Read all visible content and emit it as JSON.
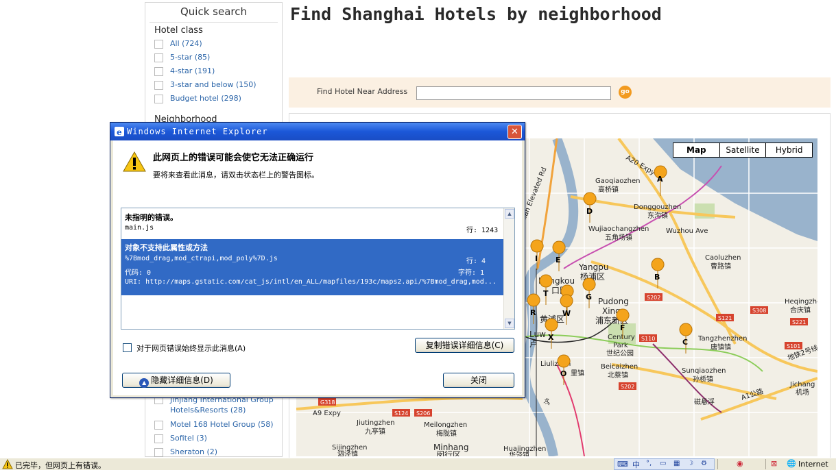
{
  "sidebar": {
    "title": "Quick search",
    "hotel_class": {
      "heading": "Hotel class",
      "items": [
        "All (724)",
        "5-star (85)",
        "4-star (191)",
        "3-star and below (150)",
        "Budget hotel (298)"
      ]
    },
    "neighborhood": {
      "heading": "Neighborhood"
    },
    "brands": [
      "Jinjiang International Group Hotels&Resorts (28)",
      "Motel 168 Hotel Group (58)",
      "Sofitel (3)",
      "Sheraton (2)"
    ]
  },
  "main": {
    "title": "Find Shanghai Hotels by neighborhood",
    "search": {
      "label": "Find Hotel Near Address",
      "value": "",
      "go_label": "go"
    }
  },
  "map": {
    "types": [
      "Map",
      "Satellite",
      "Hybrid"
    ],
    "selected_type": "Map",
    "labels": {
      "gaoqiao": "Gaoqiaozhen",
      "gaoqiao_cn": "高桥镇",
      "donggou": "Donggouzhen",
      "donggou_cn": "东沟镇",
      "wujiao": "Wujiaochangzhen",
      "wujiao_cn": "五角场镇",
      "wuzhou": "Wuzhou Ave",
      "yangpu": "Yangpu",
      "yangpu_cn": "杨浦区",
      "hongkou": "Hongkou",
      "hongkou_cn": "口区",
      "pudong": "Pudong",
      "xinqu": "Xinqu",
      "pudong_cn": "浦东新区",
      "caolu": "Caoluzhen",
      "caolu_cn": "曹路镇",
      "heqing": "Heqingzhen",
      "heqing_cn": "合庆镇",
      "huangpu_cn": "黄浦区",
      "luwan": "Luw",
      "lu_cn": "卢",
      "century": "Century",
      "park": "Park",
      "park_cn": "世纪公园",
      "tangzhen": "Tangzhenzhen",
      "tangzhen_cn": "唐镇镇",
      "liulizhen": "Liulizhen",
      "li_cn": "里镇",
      "beicai": "Beicaizhen",
      "beicai_cn": "北蔡镇",
      "sunqiao": "Sunqiaozhen",
      "sunqiao_cn": "孙桥镇",
      "jichang": "Jichang",
      "jichang_cn": "机场",
      "cixian": "磁悬浮",
      "a1": "A1公路",
      "metro2": "地铁2号线",
      "jiuting": "Jiutingzhen",
      "jiuting_cn": "九亭镇",
      "meilong": "Meilongzhen",
      "meilong_cn": "梅陇镇",
      "sijing": "Sijingzhen",
      "sijing_cn": "泗泾镇",
      "minhang": "Minhang",
      "minhang_cn": "闵行区",
      "huajing": "Huajingzhen",
      "huajing_cn": "华泾镇",
      "a20": "A20 Expy",
      "a9": "A9 Expy",
      "yixian": "Yixian Elevated Rd",
      "s202a": "S202",
      "s202b": "S202",
      "s110": "S110",
      "s121": "S121",
      "s308": "S308",
      "s221": "S221",
      "s101": "S101",
      "s124": "S124",
      "s206": "S206",
      "g318": "G318",
      "hu": "沪"
    },
    "markers": [
      "A",
      "B",
      "C",
      "D",
      "E",
      "F",
      "G",
      "I",
      "T",
      "U",
      "R",
      "W",
      "X",
      "O"
    ]
  },
  "dialog": {
    "title": "Windows Internet Explorer",
    "close_glyph": "✕",
    "heading": "此网页上的错误可能会使它无法正确运行",
    "hint": "要将来查看此消息，请双击状态栏上的警告图标。",
    "errors": [
      {
        "message": "未指明的错误。",
        "file": "main.js",
        "line": "行: 1243"
      },
      {
        "message": "对象不支持此属性或方法",
        "file": "%7Bmod_drag,mod_ctrapi,mod_poly%7D.js",
        "line": "行: 4",
        "code": "代码: 0",
        "char": "字符: 1",
        "uri": "URI: http://maps.gstatic.com/cat_js/intl/en_ALL/mapfiles/193c/maps2.api/%7Bmod_drag,mod..."
      }
    ],
    "always_show_label": "对于网页错误始终显示此消息(A)",
    "copy_button": "复制错误详细信息(C)",
    "hide_button": "隐藏详细信息(D)",
    "close_button": "关闭"
  },
  "statusbar": {
    "text": "已完毕，但网页上有错误。",
    "zone": "Internet",
    "ime": "中"
  }
}
